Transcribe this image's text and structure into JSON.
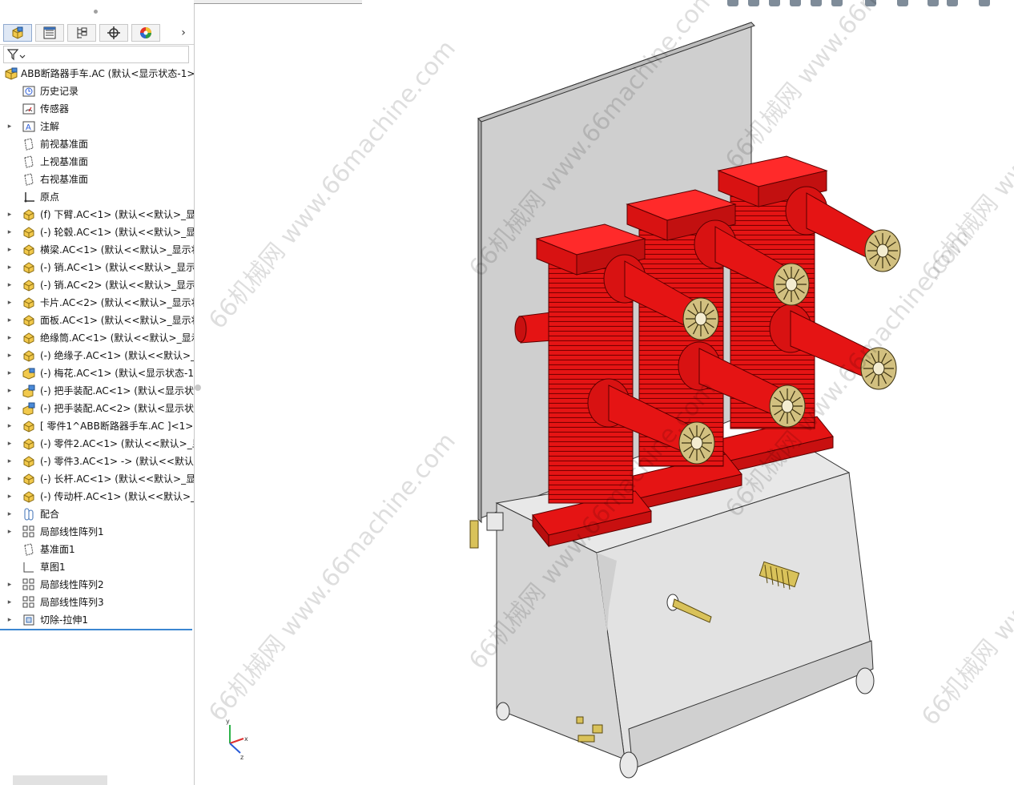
{
  "tree": {
    "root": "ABB断路器手车.AC  (默认<显示状态-1>)",
    "items": [
      {
        "label": "历史记录",
        "icon": "history-icon",
        "expand": false
      },
      {
        "label": "传感器",
        "icon": "sensor-icon",
        "expand": false
      },
      {
        "label": "注解",
        "icon": "annotation-icon",
        "expand": true
      },
      {
        "label": "前视基准面",
        "icon": "plane-icon",
        "expand": false
      },
      {
        "label": "上视基准面",
        "icon": "plane-icon",
        "expand": false
      },
      {
        "label": "右视基准面",
        "icon": "plane-icon",
        "expand": false
      },
      {
        "label": "原点",
        "icon": "origin-icon",
        "expand": false
      },
      {
        "label": "(f) 下臂.AC<1> (默认<<默认>_显示状",
        "icon": "part-icon",
        "expand": true
      },
      {
        "label": "(-) 轮毂.AC<1> (默认<<默认>_显示状",
        "icon": "part-icon",
        "expand": true
      },
      {
        "label": "横梁.AC<1> (默认<<默认>_显示状",
        "icon": "part-icon",
        "expand": true
      },
      {
        "label": "(-) 销.AC<1> (默认<<默认>_显示状",
        "icon": "part-icon",
        "expand": true
      },
      {
        "label": "(-) 销.AC<2> (默认<<默认>_显示状",
        "icon": "part-icon",
        "expand": true
      },
      {
        "label": "卡片.AC<2> (默认<<默认>_显示状",
        "icon": "part-icon",
        "expand": true
      },
      {
        "label": "面板.AC<1> (默认<<默认>_显示状",
        "icon": "part-icon",
        "expand": true
      },
      {
        "label": "绝缘筒.AC<1> (默认<<默认>_显示",
        "icon": "part-icon",
        "expand": true
      },
      {
        "label": "(-) 绝缘子.AC<1> (默认<<默认>_显",
        "icon": "part-icon",
        "expand": true
      },
      {
        "label": "(-) 梅花.AC<1> (默认<显示状态-1>",
        "icon": "assembly-icon",
        "expand": true
      },
      {
        "label": "(-) 把手装配.AC<1> (默认<显示状态",
        "icon": "subassembly-icon",
        "expand": true
      },
      {
        "label": "(-) 把手装配.AC<2> (默认<显示状态",
        "icon": "subassembly-icon",
        "expand": true
      },
      {
        "label": "[ 零件1^ABB断路器手车.AC ]<1> -",
        "icon": "part-icon",
        "expand": true
      },
      {
        "label": "(-) 零件2.AC<1> (默认<<默认>_显",
        "icon": "part-icon",
        "expand": true
      },
      {
        "label": "(-) 零件3.AC<1> -> (默认<<默认>_",
        "icon": "part-icon",
        "expand": true
      },
      {
        "label": "(-) 长杆.AC<1> (默认<<默认>_显示",
        "icon": "part-icon",
        "expand": true
      },
      {
        "label": "(-) 传动杆.AC<1> (默认<<默认>_显",
        "icon": "part-icon",
        "expand": true
      },
      {
        "label": "配合",
        "icon": "mate-icon",
        "expand": true
      },
      {
        "label": "局部线性阵列1",
        "icon": "pattern-icon",
        "expand": true
      },
      {
        "label": "基准面1",
        "icon": "plane-icon",
        "expand": false
      },
      {
        "label": "草图1",
        "icon": "sketch-icon",
        "expand": false
      },
      {
        "label": "局部线性阵列2",
        "icon": "pattern-icon",
        "expand": true
      },
      {
        "label": "局部线性阵列3",
        "icon": "pattern-icon",
        "expand": true
      },
      {
        "label": "切除-拉伸1",
        "icon": "cut-extrude-icon",
        "expand": true
      }
    ]
  },
  "watermark": {
    "text": "66机械网 www.66machine.com"
  },
  "axes": {
    "x": "x",
    "y": "y",
    "z": "z"
  },
  "colors": {
    "accent": "#3b86d1",
    "part_red": "#e51414",
    "frame_gray": "#d4d4d4",
    "contact_gold": "#c9b56a"
  }
}
